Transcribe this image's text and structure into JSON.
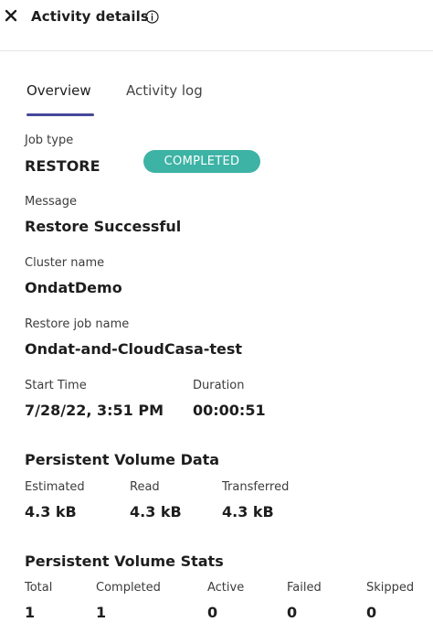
{
  "header": {
    "title": "Activity details",
    "close_icon": "close-icon",
    "info_icon": "info-icon"
  },
  "tabs": [
    {
      "label": "Overview",
      "active": true
    },
    {
      "label": "Activity log",
      "active": false
    }
  ],
  "colors": {
    "accent": "#45489a",
    "status_completed": "#3db3a5"
  },
  "job": {
    "type_label": "Job type",
    "type_value": "RESTORE",
    "status": "COMPLETED",
    "message_label": "Message",
    "message_value": "Restore Successful",
    "cluster_label": "Cluster name",
    "cluster_value": "OndatDemo",
    "restore_name_label": "Restore job name",
    "restore_name_value": "Ondat-and-CloudCasa-test",
    "start_time_label": "Start Time",
    "start_time_value": "7/28/22, 3:51 PM",
    "duration_label": "Duration",
    "duration_value": "00:00:51"
  },
  "volume_data": {
    "title": "Persistent Volume Data",
    "estimated_label": "Estimated",
    "estimated_value": "4.3 kB",
    "read_label": "Read",
    "read_value": "4.3 kB",
    "transferred_label": "Transferred",
    "transferred_value": "4.3 kB"
  },
  "volume_stats": {
    "title": "Persistent Volume Stats",
    "total_label": "Total",
    "total_value": "1",
    "completed_label": "Completed",
    "completed_value": "1",
    "active_label": "Active",
    "active_value": "0",
    "failed_label": "Failed",
    "failed_value": "0",
    "skipped_label": "Skipped",
    "skipped_value": "0"
  }
}
